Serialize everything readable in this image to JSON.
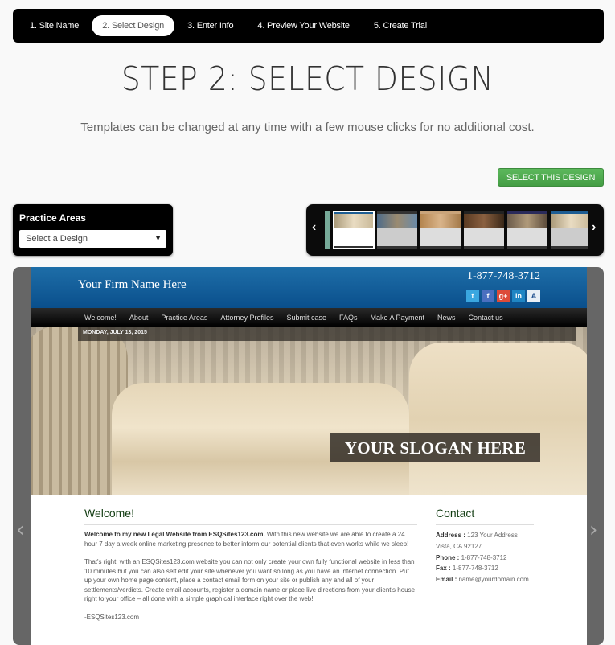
{
  "steps": [
    {
      "label": "1. Site Name",
      "active": false
    },
    {
      "label": "2. Select Design",
      "active": true
    },
    {
      "label": "3. Enter Info",
      "active": false
    },
    {
      "label": "4. Preview Your Website",
      "active": false
    },
    {
      "label": "5. Create Trial",
      "active": false
    }
  ],
  "page": {
    "title": "STEP 2: SELECT DESIGN",
    "subtitle": "Templates can be changed at any time with a few mouse clicks for no additional cost.",
    "select_button": "SELECT THIS DESIGN"
  },
  "practice_areas": {
    "title": "Practice Areas",
    "selected": "Select a Design",
    "arrow": "▼"
  },
  "carousel": {
    "prev": "‹",
    "next": "›",
    "thumbnails": [
      "Design 1",
      "Design 2",
      "Design 3",
      "Design 4",
      "Design 5",
      "Design 6"
    ],
    "selected_index": 0
  },
  "preview": {
    "prev": "‹",
    "next": "›",
    "firm_name": "Your Firm Name Here",
    "phone": "1-877-748-3712",
    "social": [
      {
        "name": "twitter",
        "glyph": "t",
        "color": "#3aa7e0"
      },
      {
        "name": "facebook",
        "glyph": "f",
        "color": "#4a6fbf"
      },
      {
        "name": "google-plus",
        "glyph": "g+",
        "color": "#dd4b39"
      },
      {
        "name": "linkedin",
        "glyph": "in",
        "color": "#1f86c4"
      },
      {
        "name": "avvo",
        "glyph": "A",
        "color": "#e8eef5"
      }
    ],
    "nav": [
      "Welcome!",
      "About",
      "Practice Areas",
      "Attorney Profiles",
      "Submit case",
      "FAQs",
      "Make A Payment",
      "News",
      "Contact us"
    ],
    "date": "MONDAY, JULY 13, 2015",
    "slogan": "YOUR SLOGAN HERE",
    "welcome": {
      "heading": "Welcome!",
      "intro_bold": "Welcome to my new Legal Website from ESQSites123.com.",
      "intro_rest": " With this new website we are able to create a 24 hour 7 day a week online marketing presence to better inform our potential clients that even works while we sleep!",
      "para2": "That's right, with an ESQSites123.com website you can not only create your own fully functional website in less than 10 minutes but you can also self edit your site whenever you want so long as you have an internet connection. Put up your own home page content, place a contact email form on your site or publish any and all of your settlements/verdicts. Create email accounts, register a domain name or place live directions from your client's house right to your office – all done with a simple graphical interface right over the web!",
      "signature": "-ESQSites123.com"
    },
    "contact": {
      "heading": "Contact",
      "address_label": "Address :",
      "address_line1": " 123 Your Address",
      "address_line2": "Vista, CA 92127",
      "phone_label": "Phone :",
      "phone": " 1-877-748-3712",
      "fax_label": "Fax :",
      "fax": " 1-877-748-3712",
      "email_label": "Email :",
      "email": " name@yourdomain.com"
    }
  }
}
